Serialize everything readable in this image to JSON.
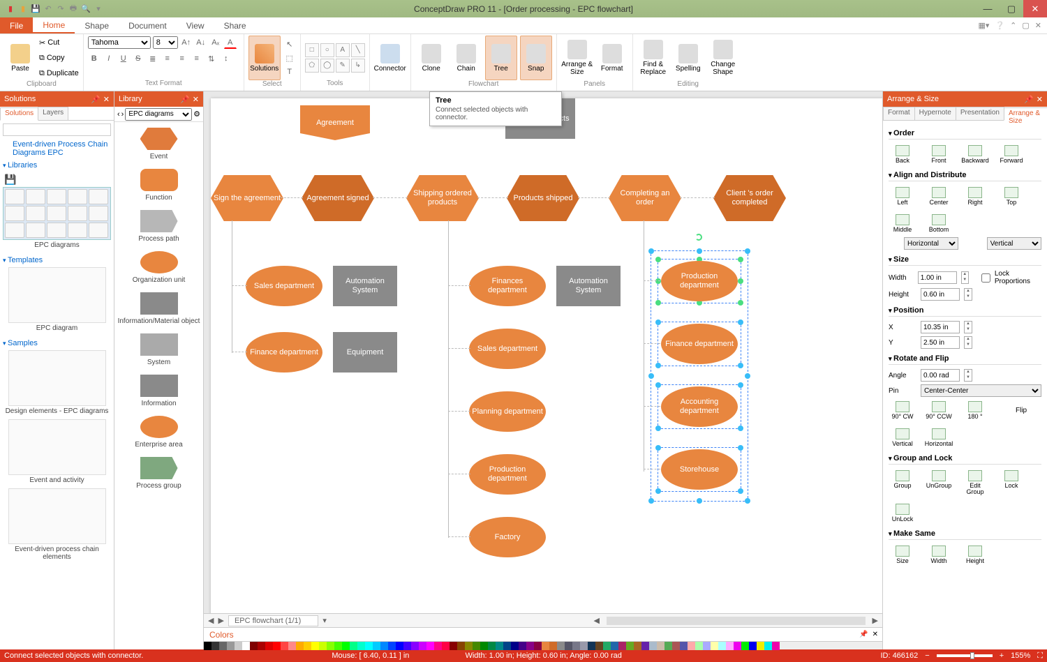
{
  "app": {
    "title": "ConceptDraw PRO 11 - [Order processing - EPC flowchart]"
  },
  "menutabs": {
    "file": "File",
    "items": [
      "Home",
      "Shape",
      "Document",
      "View",
      "Share"
    ],
    "active": "Home"
  },
  "ribbon": {
    "clipboard": {
      "paste": "Paste",
      "cut": "Cut",
      "copy": "Copy",
      "duplicate": "Duplicate",
      "label": "Clipboard"
    },
    "textformat": {
      "font": "Tahoma",
      "size": "8",
      "label": "Text Format"
    },
    "solutions": {
      "btn": "Solutions",
      "label": "Select"
    },
    "tools": {
      "label": "Tools"
    },
    "connector": {
      "btn": "Connector"
    },
    "flowchart": {
      "clone": "Clone",
      "chain": "Chain",
      "tree": "Tree",
      "snap": "Snap",
      "label": "Flowchart"
    },
    "panels": {
      "arrange": "Arrange & Size",
      "format": "Format",
      "label": "Panels"
    },
    "editing": {
      "find": "Find & Replace",
      "spelling": "Spelling",
      "change": "Change Shape",
      "label": "Editing"
    }
  },
  "tooltip": {
    "title": "Tree",
    "text": "Connect selected objects with connector."
  },
  "solutions": {
    "hdr": "Solutions",
    "tabs": [
      "Solutions",
      "Layers"
    ],
    "tree_root": "Event-driven Process Chain Diagrams EPC",
    "sec_lib": "Libraries",
    "lib_caption": "EPC diagrams",
    "sec_tpl": "Templates",
    "tpl_caption": "EPC diagram",
    "sec_smp": "Samples",
    "smp1": "Design elements - EPC diagrams",
    "smp2": "Event and activity",
    "smp3": "Event-driven process chain elements"
  },
  "library": {
    "hdr": "Library",
    "selector": "EPC diagrams",
    "items": [
      "Event",
      "Function",
      "Process path",
      "Organization unit",
      "Information/Material object",
      "System",
      "Information",
      "Enterprise area",
      "Process group"
    ]
  },
  "canvas": {
    "agreement_banner": "Agreement",
    "ordered_products": "ordered products",
    "row1": [
      "Sign the agreement",
      "Agreement signed",
      "Shipping ordered products",
      "Products shipped",
      "Completing an order",
      "Client 's order completed"
    ],
    "sales1": "Sales department",
    "auto1": "Automation System",
    "finances": "Finances department",
    "auto2": "Automation System",
    "finance1": "Finance department",
    "equipment": "Equipment",
    "sales2": "Sales department",
    "planning": "Planning department",
    "production_c": "Production department",
    "factory": "Factory",
    "sel_nodes": [
      "Production department",
      "Finance department",
      "Accounting department",
      "Storehouse"
    ],
    "page_tab": "EPC flowchart (1/1)"
  },
  "colors_label": "Colors",
  "arrange": {
    "hdr": "Arrange & Size",
    "tabs": [
      "Format",
      "Hypernote",
      "Presentation",
      "Arrange & Size"
    ],
    "sec_order": "Order",
    "order": [
      "Back",
      "Front",
      "Backward",
      "Forward"
    ],
    "sec_align": "Align and Distribute",
    "align_h": [
      "Left",
      "Center",
      "Right"
    ],
    "align_v": [
      "Top",
      "Middle",
      "Bottom"
    ],
    "dist_h": "Horizontal",
    "dist_v": "Vertical",
    "sec_size": "Size",
    "width_l": "Width",
    "width_v": "1.00 in",
    "height_l": "Height",
    "height_v": "0.60 in",
    "lockprop": "Lock Proportions",
    "sec_pos": "Position",
    "x_l": "X",
    "x_v": "10.35 in",
    "y_l": "Y",
    "y_v": "2.50 in",
    "sec_rot": "Rotate and Flip",
    "angle_l": "Angle",
    "angle_v": "0.00 rad",
    "pin_l": "Pin",
    "pin_v": "Center-Center",
    "rot_btns": [
      "90° CW",
      "90° CCW",
      "180 °"
    ],
    "flip_l": "Flip",
    "flip_btns": [
      "Vertical",
      "Horizontal"
    ],
    "sec_group": "Group and Lock",
    "group_btns": [
      "Group",
      "UnGroup",
      "Edit Group",
      "Lock",
      "UnLock"
    ],
    "sec_make": "Make Same",
    "make_btns": [
      "Size",
      "Width",
      "Height"
    ]
  },
  "status": {
    "left": "Connect selected objects with connector.",
    "mouse": "Mouse: [ 6.40, 0.11 ] in",
    "dims": "Width: 1.00 in;  Height: 0.60 in;  Angle: 0.00 rad",
    "id": "ID: 466162",
    "zoom": "155%"
  }
}
